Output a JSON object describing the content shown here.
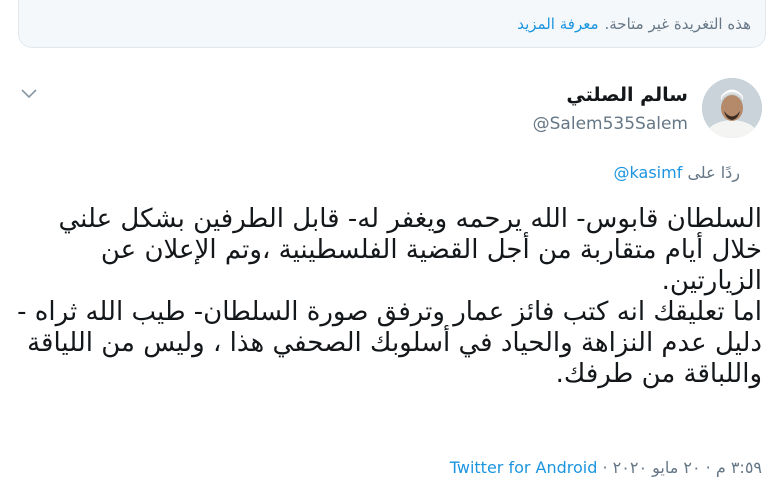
{
  "notice": {
    "text": "هذه التغريدة غير متاحة.",
    "link": "معرفة المزيد"
  },
  "tweet": {
    "display_name": "سالم الصلتي",
    "handle": "@Salem535Salem",
    "replying_prefix": "ردًا على",
    "replying_to": "@kasimf",
    "text": "السلطان قابوس- الله يرحمه ويغفر له- قابل الطرفين بشكل علني خلال أيام متقاربة من أجل القضية الفلسطينية ،وتم الإعلان عن الزيارتين.\nاما تعليقك انه كتب فائز عمار وترفق صورة السلطان- طيب الله ثراه - دليل عدم النزاهة والحياد في أسلوبك الصحفي هذا ، وليس من اللياقة واللباقة من طرفك.",
    "timestamp": "٣:٥٩ م · ٢٠ مايو ٢٠٢٠ ·",
    "source": "Twitter for Android"
  },
  "icons": {
    "menu": "chevron-down-icon",
    "avatar": "avatar"
  },
  "colors": {
    "link": "#1b95e0",
    "muted": "#657786",
    "text": "#14171a",
    "notice_bg": "#f5f8fa"
  }
}
